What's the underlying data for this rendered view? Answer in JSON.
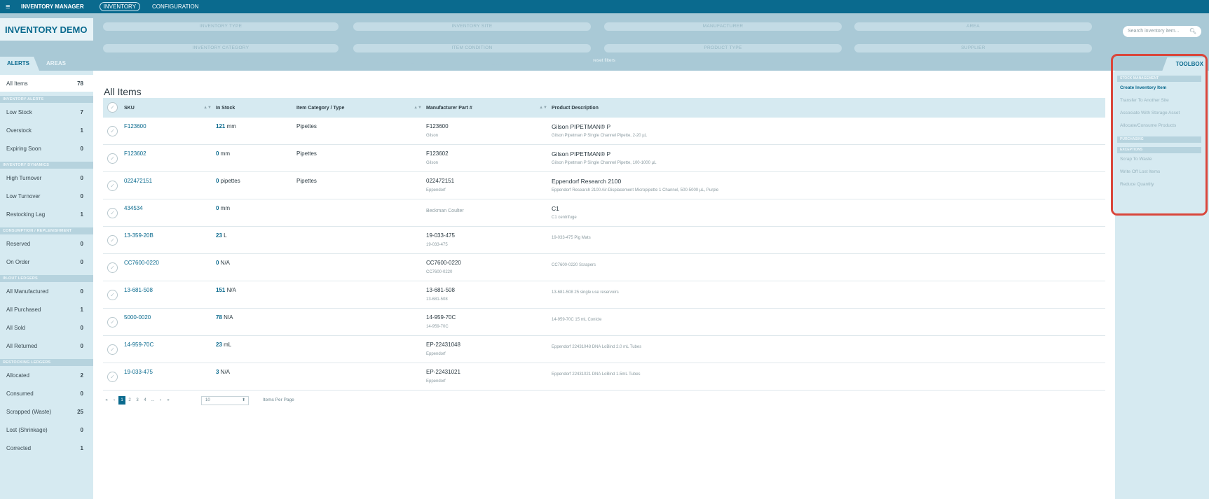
{
  "topbar": {
    "menu_icon": "≡",
    "app_title": "INVENTORY MANAGER",
    "tabs": [
      {
        "label": "INVENTORY",
        "active": true
      },
      {
        "label": "CONFIGURATION",
        "active": false
      }
    ]
  },
  "header": {
    "demo_title": "INVENTORY DEMO",
    "filters_row1": [
      "INVENTORY TYPE",
      "INVENTORY SITE",
      "MANUFACTURER",
      "AREA"
    ],
    "filters_row2": [
      "INVENTORY CATEGORY",
      "ITEM CONDITION",
      "PRODUCT TYPE",
      "SUPPLIER"
    ],
    "reset_label": "reset filters",
    "search_placeholder": "Search inventory item...",
    "left_tabs": [
      "ALERTS",
      "AREAS"
    ]
  },
  "sidebar": {
    "top_item": {
      "label": "All Items",
      "count": "78"
    },
    "sections": [
      {
        "heading": "INVENTORY ALERTS",
        "items": [
          {
            "label": "Low Stock",
            "count": "7"
          },
          {
            "label": "Overstock",
            "count": "1"
          },
          {
            "label": "Expiring Soon",
            "count": "0"
          }
        ]
      },
      {
        "heading": "INVENTORY DYNAMICS",
        "items": [
          {
            "label": "High Turnover",
            "count": "0"
          },
          {
            "label": "Low Turnover",
            "count": "0"
          },
          {
            "label": "Restocking Lag",
            "count": "1"
          }
        ]
      },
      {
        "heading": "CONSUMPTION / REPLENISHMENT",
        "items": [
          {
            "label": "Reserved",
            "count": "0"
          },
          {
            "label": "On Order",
            "count": "0"
          }
        ]
      },
      {
        "heading": "IN-OUT LEDGERS",
        "items": [
          {
            "label": "All Manufactured",
            "count": "0"
          },
          {
            "label": "All Purchased",
            "count": "1"
          },
          {
            "label": "All Sold",
            "count": "0"
          },
          {
            "label": "All Returned",
            "count": "0"
          }
        ]
      },
      {
        "heading": "RESTOCKING LEDGERS",
        "items": [
          {
            "label": "Allocated",
            "count": "2"
          },
          {
            "label": "Consumed",
            "count": "0"
          },
          {
            "label": "Scrapped (Waste)",
            "count": "25"
          },
          {
            "label": "Lost (Shrinkage)",
            "count": "0"
          },
          {
            "label": "Corrected",
            "count": "1"
          }
        ]
      }
    ]
  },
  "main": {
    "title": "All Items",
    "columns": [
      "SKU",
      "In Stock",
      "Item Category / Type",
      "Manufacturer Part #",
      "Product Description"
    ],
    "rows": [
      {
        "sku": "F123600",
        "qty": "121",
        "unit": "mm",
        "category": "Pipettes",
        "mfr_part": "F123600",
        "mfr_name": "Gilson",
        "desc_title": "Gilson PIPETMAN® P",
        "desc_sub": "Gilson Pipetman P Single Channel Pipette, 2-20 µL"
      },
      {
        "sku": "F123602",
        "qty": "0",
        "unit": "mm",
        "category": "Pipettes",
        "mfr_part": "F123602",
        "mfr_name": "Gilson",
        "desc_title": "Gilson PIPETMAN® P",
        "desc_sub": "Gilson Pipetman P Single Channel Pipette, 100-1000 µL"
      },
      {
        "sku": "022472151",
        "qty": "0",
        "unit": "pipettes",
        "category": "Pipettes",
        "mfr_part": "022472151",
        "mfr_name": "Eppendorf",
        "desc_title": "Eppendorf Research 2100",
        "desc_sub": "Eppendorf Research 2100 Air-Displacement Micropipette 1 Channel, 500-5000 µL, Purple"
      },
      {
        "sku": "434534",
        "qty": "0",
        "unit": "mm",
        "category": "",
        "mfr_part": "",
        "mfr_name": "Beckman Coulter",
        "desc_title": "C1",
        "desc_sub": "C1 centrifuge"
      },
      {
        "sku": "13-359-20B",
        "qty": "23",
        "unit": "L",
        "category": "",
        "mfr_part": "19-033-475",
        "mfr_name": "19-033-475",
        "desc_title": "",
        "desc_sub": "19-033-475 Pig Mats"
      },
      {
        "sku": "CC7600-0220",
        "qty": "0",
        "unit": "N/A",
        "category": "",
        "mfr_part": "CC7600-0220",
        "mfr_name": "CC7600-0220",
        "desc_title": "",
        "desc_sub": "CC7600-0220 Scrapers"
      },
      {
        "sku": "13-681-508",
        "qty": "151",
        "unit": "N/A",
        "category": "",
        "mfr_part": "13-681-508",
        "mfr_name": "13-681-508",
        "desc_title": "",
        "desc_sub": "13-681-508 25 single use reservoirs"
      },
      {
        "sku": "5000-0020",
        "qty": "78",
        "unit": "N/A",
        "category": "",
        "mfr_part": "14-959-70C",
        "mfr_name": "14-959-70C",
        "desc_title": "",
        "desc_sub": "14-959-70C 15 mL Conicle"
      },
      {
        "sku": "14-959-70C",
        "qty": "23",
        "unit": "mL",
        "category": "",
        "mfr_part": "EP-22431048",
        "mfr_name": "Eppendorf",
        "desc_title": "",
        "desc_sub": "Eppendorf 22431048 DNA LoBind 2.0 mL Tubes"
      },
      {
        "sku": "19-033-475",
        "qty": "3",
        "unit": "N/A",
        "category": "",
        "mfr_part": "EP-22431021",
        "mfr_name": "Eppendorf",
        "desc_title": "",
        "desc_sub": "Eppendorf 22431021 DNA LoBind 1.5mL Tubes"
      }
    ],
    "pager": {
      "buttons": [
        "«",
        "‹",
        "1",
        "2",
        "3",
        "4",
        "...",
        "›",
        "»"
      ],
      "current": "1",
      "per_page_value": "10",
      "per_page_label": "Items Per Page"
    }
  },
  "toolbox": {
    "tab_label": "TOOLBOX",
    "sections": [
      {
        "heading": "STOCK MANAGEMENT",
        "items": [
          {
            "label": "Create Inventory Item",
            "active": true
          },
          {
            "label": "Transfer To Another Site",
            "active": false
          },
          {
            "label": "Associate With Storage Asset",
            "active": false
          },
          {
            "label": "Allocate/Consume Products",
            "active": false
          }
        ]
      },
      {
        "heading": "PURCHASING",
        "items": []
      },
      {
        "heading": "EXCEPTIONS",
        "items": [
          {
            "label": "Scrap To Waste",
            "active": false
          },
          {
            "label": "Write Off Lost Items",
            "active": false
          },
          {
            "label": "Reduce Quantity",
            "active": false
          }
        ]
      }
    ]
  },
  "colors": {
    "brand": "#0a6a8e",
    "header_bg": "#a9c9d6",
    "panel_bg": "#d6eaf1",
    "highlight": "#d9463b"
  }
}
